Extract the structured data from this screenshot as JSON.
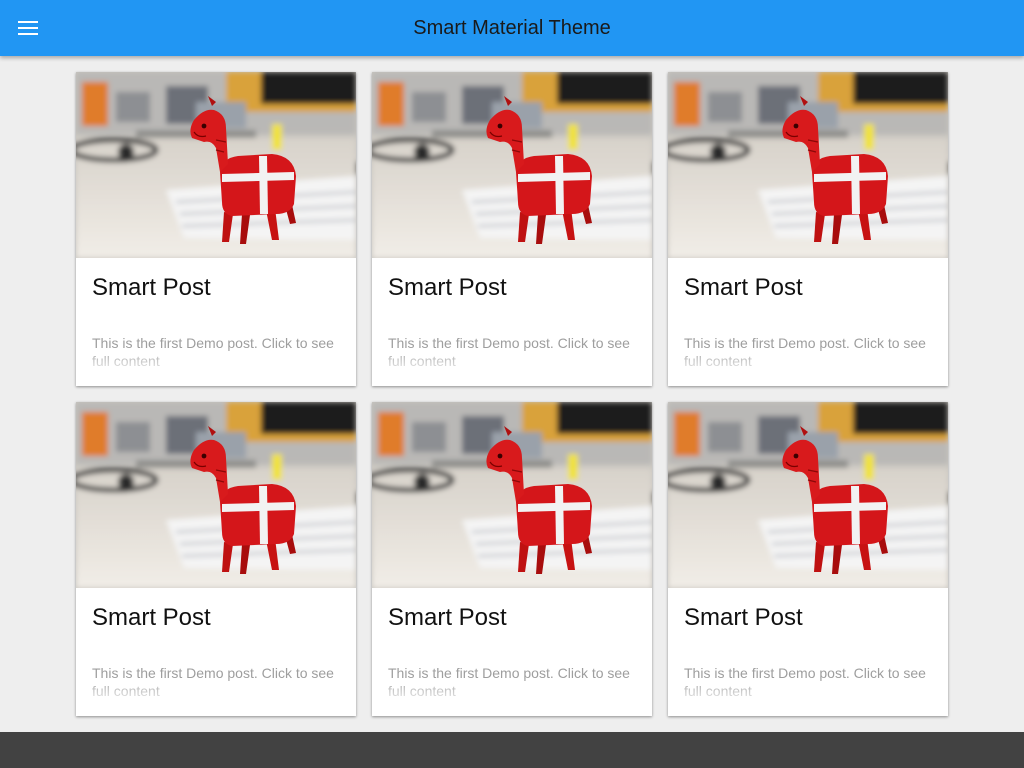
{
  "app_bar": {
    "title": "Smart Material Theme",
    "menu_icon": "menu-icon",
    "background_color": "#2196f3"
  },
  "posts": [
    {
      "title": "Smart Post",
      "excerpt": "This is the first Demo post. Click to see full content"
    },
    {
      "title": "Smart Post",
      "excerpt": "This is the first Demo post. Click to see full content"
    },
    {
      "title": "Smart Post",
      "excerpt": "This is the first Demo post. Click to see full content"
    },
    {
      "title": "Smart Post",
      "excerpt": "This is the first Demo post. Click to see full content"
    },
    {
      "title": "Smart Post",
      "excerpt": "This is the first Demo post. Click to see full content"
    },
    {
      "title": "Smart Post",
      "excerpt": "This is the first Demo post. Click to see full content"
    }
  ],
  "footer": {
    "background_color": "#424242"
  }
}
